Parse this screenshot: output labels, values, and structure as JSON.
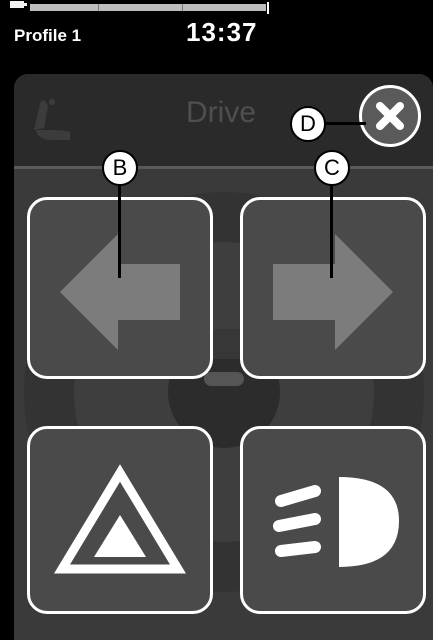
{
  "status": {
    "profile_label": "Profile 1",
    "time": "13:37"
  },
  "panel": {
    "mode_title": "Drive",
    "seat_icon": "seat-icon",
    "close_icon": "close-icon"
  },
  "buttons": {
    "left_indicator_icon": "arrow-left-icon",
    "right_indicator_icon": "arrow-right-icon",
    "hazard_icon": "hazard-warning-icon",
    "lights_icon": "headlight-icon"
  },
  "callouts": {
    "b": "B",
    "c": "C",
    "d": "D"
  },
  "colors": {
    "panel_bg": "#3a3a3a",
    "header_bg": "#2a2a2a",
    "button_bg": "#4a4a4a",
    "icon_dim": "#7c7c7c",
    "icon_bright": "#ffffff"
  }
}
